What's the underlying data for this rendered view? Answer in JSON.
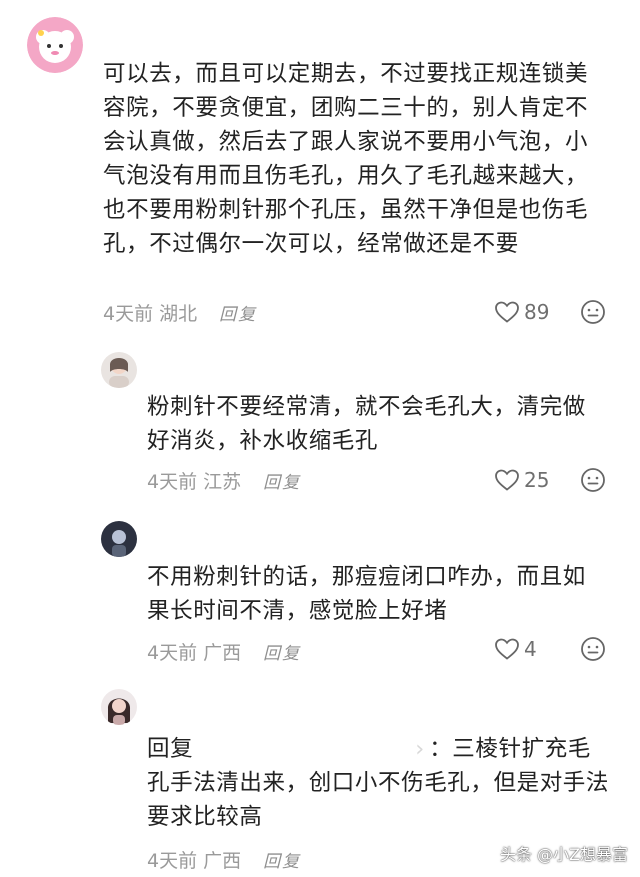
{
  "comments": [
    {
      "text": "可以去，而且可以定期去，不过要找正规连锁美容院，不要贪便宜，团购二三十的，别人肯定不会认真做，然后去了跟人家说不要用小气泡，小气泡没有用而且伤毛孔，用久了毛孔越来越大，也不要用粉刺针那个孔压，虽然干净但是也伤毛孔，不过偶尔一次可以，经常做还是不要",
      "time": "4天前",
      "location": "湖北",
      "reply_label": "回复",
      "likes": "89"
    },
    {
      "text": "粉刺针不要经常清，就不会毛孔大，清完做好消炎，补水收缩毛孔",
      "time": "4天前",
      "location": "江苏",
      "reply_label": "回复",
      "likes": "25"
    },
    {
      "text": "不用粉刺针的话，那痘痘闭口咋办，而且如果长时间不清，感觉脸上好堵",
      "time": "4天前",
      "location": "广西",
      "reply_label": "回复",
      "likes": "4"
    },
    {
      "reply_prefix": "回复",
      "text_after_mention": "：三棱针扩充毛孔手法清出来，创口小不伤毛孔，但是对手法要求比较高",
      "time": "4天前",
      "location": "广西",
      "reply_label": "回复"
    }
  ],
  "watermark": "头条 @小Z想暴富",
  "icons": {
    "like": "heart-outline-icon",
    "emoji": "neutral-face-icon"
  },
  "colors": {
    "text": "#222222",
    "meta": "#9a9a9a",
    "icon": "#6f6f6f"
  }
}
